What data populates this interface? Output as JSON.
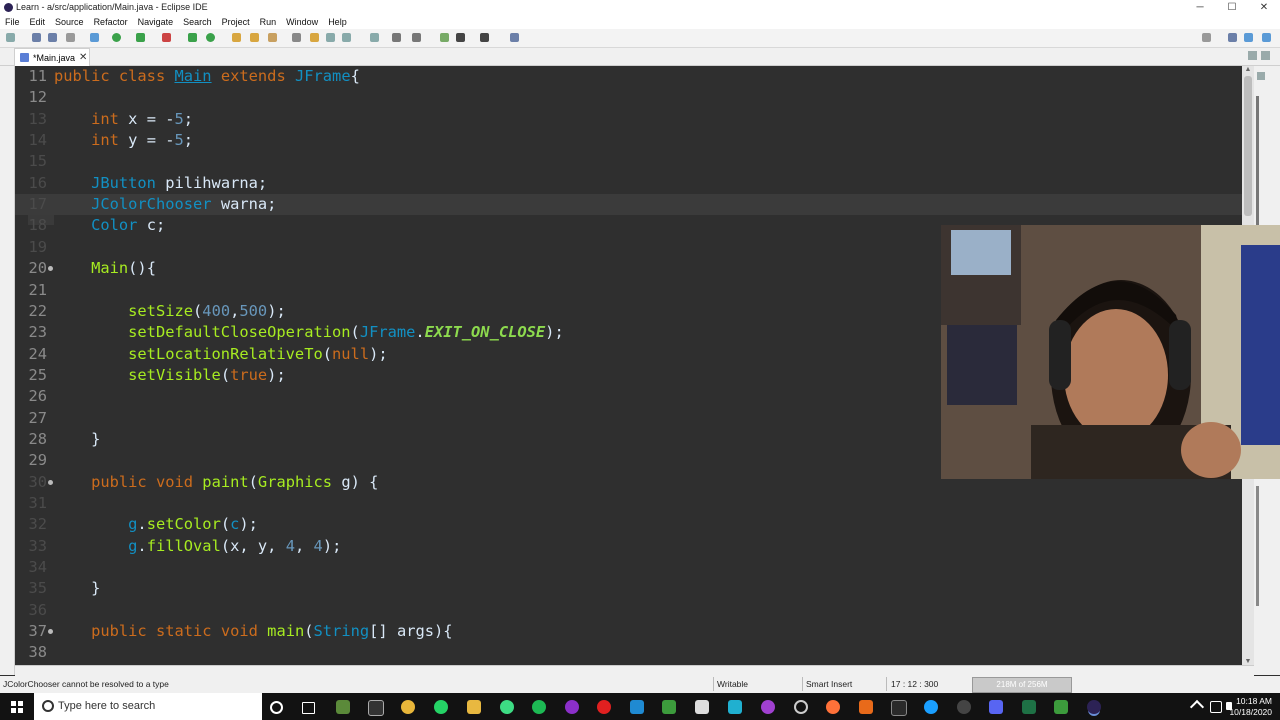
{
  "window": {
    "title": "Learn - a/src/application/Main.java - Eclipse IDE",
    "controls": [
      "─",
      "☐",
      "✕"
    ]
  },
  "menu": [
    "File",
    "Edit",
    "Source",
    "Refactor",
    "Navigate",
    "Search",
    "Project",
    "Run",
    "Window",
    "Help"
  ],
  "tab": {
    "label": "*Main.java",
    "close": "✕"
  },
  "code_lines": [
    {
      "n": "11",
      "parts": [
        [
          "kw",
          "public "
        ],
        [
          "kw",
          "class "
        ],
        [
          "cls ul",
          "Main"
        ],
        [
          "txt",
          " "
        ],
        [
          "kw",
          "extends "
        ],
        [
          "cls",
          "JFrame"
        ],
        [
          "txt",
          "{"
        ]
      ]
    },
    {
      "n": "12",
      "parts": []
    },
    {
      "n": "13",
      "parts": [
        [
          "txt",
          "    "
        ],
        [
          "kw",
          "int "
        ],
        [
          "txt",
          "x = -"
        ],
        [
          "num",
          "5"
        ],
        [
          "txt",
          ";"
        ]
      ]
    },
    {
      "n": "14",
      "parts": [
        [
          "txt",
          "    "
        ],
        [
          "kw",
          "int "
        ],
        [
          "txt",
          "y = -"
        ],
        [
          "num",
          "5"
        ],
        [
          "txt",
          ";"
        ]
      ]
    },
    {
      "n": "15",
      "parts": []
    },
    {
      "n": "16",
      "parts": [
        [
          "txt",
          "    "
        ],
        [
          "cls",
          "JButton "
        ],
        [
          "txt",
          "pilihwarna;"
        ]
      ]
    },
    {
      "n": "17",
      "parts": [
        [
          "txt",
          "    "
        ],
        [
          "cls",
          "JColorChooser "
        ],
        [
          "txt",
          "warna;"
        ]
      ]
    },
    {
      "n": "18",
      "parts": [
        [
          "txt",
          "    "
        ],
        [
          "cls",
          "Color "
        ],
        [
          "txt",
          "c;"
        ]
      ]
    },
    {
      "n": "19",
      "parts": []
    },
    {
      "n": "20",
      "parts": [
        [
          "txt",
          "    "
        ],
        [
          "fn",
          "Main"
        ],
        [
          "txt",
          "(){"
        ]
      ]
    },
    {
      "n": "21",
      "parts": []
    },
    {
      "n": "22",
      "parts": [
        [
          "txt",
          "        "
        ],
        [
          "fn",
          "setSize"
        ],
        [
          "txt",
          "("
        ],
        [
          "num",
          "400"
        ],
        [
          "txt",
          ","
        ],
        [
          "num",
          "500"
        ],
        [
          "txt",
          ");"
        ]
      ]
    },
    {
      "n": "23",
      "parts": [
        [
          "txt",
          "        "
        ],
        [
          "fn",
          "setDefaultCloseOperation"
        ],
        [
          "txt",
          "("
        ],
        [
          "cls",
          "JFrame"
        ],
        [
          "txt",
          "."
        ],
        [
          "cst",
          "EXIT_ON_CLOSE"
        ],
        [
          "txt",
          ");"
        ]
      ]
    },
    {
      "n": "24",
      "parts": [
        [
          "txt",
          "        "
        ],
        [
          "fn",
          "setLocationRelativeTo"
        ],
        [
          "txt",
          "("
        ],
        [
          "kw",
          "null"
        ],
        [
          "txt",
          ");"
        ]
      ]
    },
    {
      "n": "25",
      "parts": [
        [
          "txt",
          "        "
        ],
        [
          "fn",
          "setVisible"
        ],
        [
          "txt",
          "("
        ],
        [
          "kw",
          "true"
        ],
        [
          "txt",
          ");"
        ]
      ]
    },
    {
      "n": "26",
      "parts": []
    },
    {
      "n": "27",
      "parts": []
    },
    {
      "n": "28",
      "parts": [
        [
          "txt",
          "    }"
        ]
      ]
    },
    {
      "n": "29",
      "parts": []
    },
    {
      "n": "30",
      "parts": [
        [
          "txt",
          "    "
        ],
        [
          "kw",
          "public "
        ],
        [
          "kw",
          "void "
        ],
        [
          "fn",
          "paint"
        ],
        [
          "txt",
          "("
        ],
        [
          "fn",
          "Graphics "
        ],
        [
          "txt",
          "g) {"
        ]
      ]
    },
    {
      "n": "31",
      "parts": []
    },
    {
      "n": "32",
      "parts": [
        [
          "txt",
          "        "
        ],
        [
          "cls",
          "g"
        ],
        [
          "txt",
          "."
        ],
        [
          "fn",
          "setColor"
        ],
        [
          "txt",
          "("
        ],
        [
          "cls",
          "c"
        ],
        [
          "txt",
          ");"
        ]
      ]
    },
    {
      "n": "33",
      "parts": [
        [
          "txt",
          "        "
        ],
        [
          "cls",
          "g"
        ],
        [
          "txt",
          "."
        ],
        [
          "fn",
          "fillOval"
        ],
        [
          "txt",
          "(x, y, "
        ],
        [
          "num",
          "4"
        ],
        [
          "txt",
          ", "
        ],
        [
          "num",
          "4"
        ],
        [
          "txt",
          ");"
        ]
      ]
    },
    {
      "n": "34",
      "parts": []
    },
    {
      "n": "35",
      "parts": [
        [
          "txt",
          "    }"
        ]
      ]
    },
    {
      "n": "36",
      "parts": []
    },
    {
      "n": "37",
      "parts": [
        [
          "txt",
          "    "
        ],
        [
          "kw",
          "public "
        ],
        [
          "kw",
          "static "
        ],
        [
          "kw",
          "void "
        ],
        [
          "fn",
          "main"
        ],
        [
          "txt",
          "("
        ],
        [
          "cls",
          "String"
        ],
        [
          "txt",
          "[] args){"
        ]
      ]
    },
    {
      "n": "38",
      "parts": []
    }
  ],
  "status": {
    "message": "JColorChooser cannot be resolved to a type",
    "writable": "Writable",
    "insert_mode": "Smart Insert",
    "position": "17 : 12 : 300",
    "heap": "218M of 256M"
  },
  "taskbar": {
    "search_placeholder": "Type here to search",
    "time": "10:18 AM",
    "date": "10/18/2020"
  }
}
